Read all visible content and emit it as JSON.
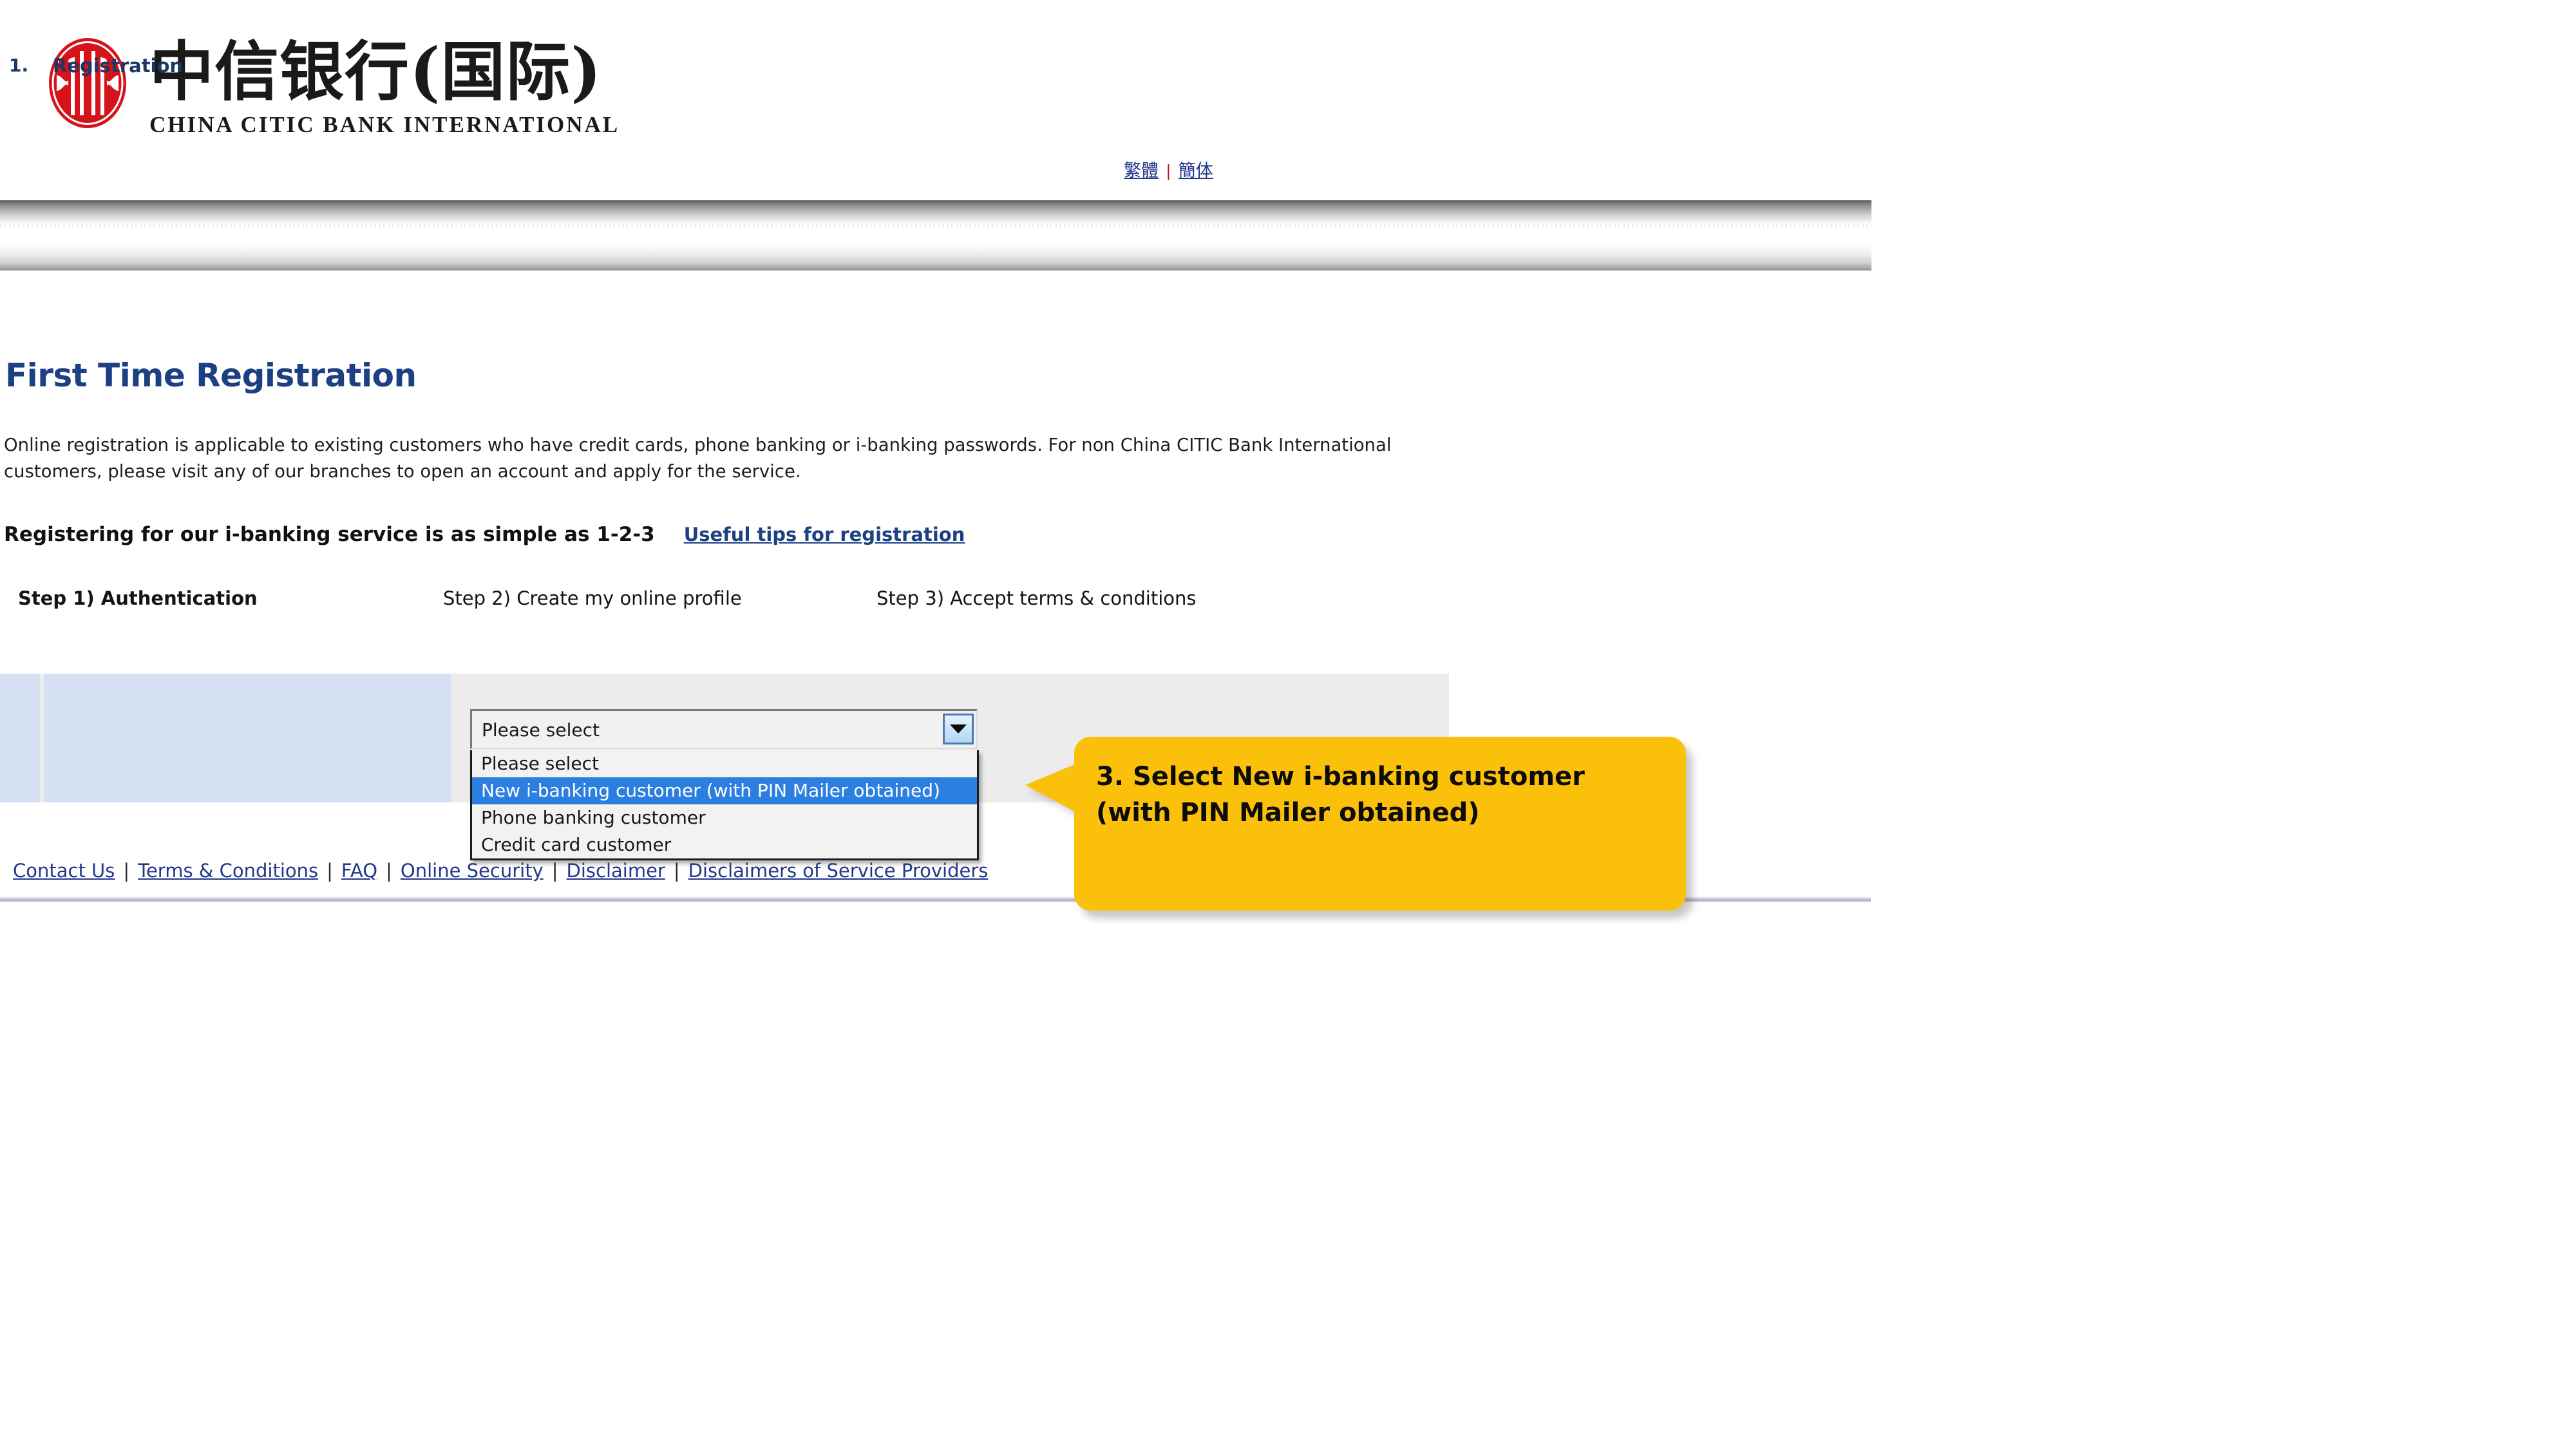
{
  "header": {
    "logo": {
      "mark_name": "citic-logo-mark",
      "chinese_name": "中信银行(国际)",
      "english_name": "CHINA CITIC BANK INTERNATIONAL",
      "mark_color": "#d6131a"
    },
    "language_links": [
      {
        "label": "繁體"
      },
      {
        "label": "簡体"
      }
    ],
    "language_separator": "|"
  },
  "main": {
    "page_title": "First Time Registration",
    "intro_paragraph": "Online registration is applicable to existing customers who have credit cards, phone banking or i-banking passwords. For non China CITIC Bank International customers, please visit any of our branches to open an account and apply for the service.",
    "tagline": "Registering for our i-banking service is as simple as 1-2-3",
    "tips_link": "Useful tips for registration",
    "steps": [
      {
        "label": "Step 1) Authentication",
        "active": true
      },
      {
        "label": "Step 2) Create my online profile",
        "active": false
      },
      {
        "label": "Step 3) Accept terms & conditions",
        "active": false
      }
    ],
    "form": {
      "row_number": "1.",
      "row_label": "Registration",
      "select": {
        "selected_value": "Please select",
        "expanded": true,
        "options": [
          {
            "label": "Please select",
            "highlighted": false
          },
          {
            "label": "New i-banking customer (with PIN Mailer obtained)",
            "highlighted": true
          },
          {
            "label": "Phone banking customer",
            "highlighted": false
          },
          {
            "label": "Credit card customer",
            "highlighted": false
          }
        ],
        "arrow_icon": "chevron-down-icon"
      }
    }
  },
  "callout": {
    "text": "3. Select New i-banking customer (with PIN Mailer obtained)",
    "background_color": "#fbc00a"
  },
  "footer": {
    "links": [
      {
        "label": "Contact Us"
      },
      {
        "label": "Terms & Conditions"
      },
      {
        "label": "FAQ"
      },
      {
        "label": "Online Security"
      },
      {
        "label": "Disclaimer"
      },
      {
        "label": "Disclaimers of Service Providers"
      }
    ],
    "separator": "|"
  }
}
